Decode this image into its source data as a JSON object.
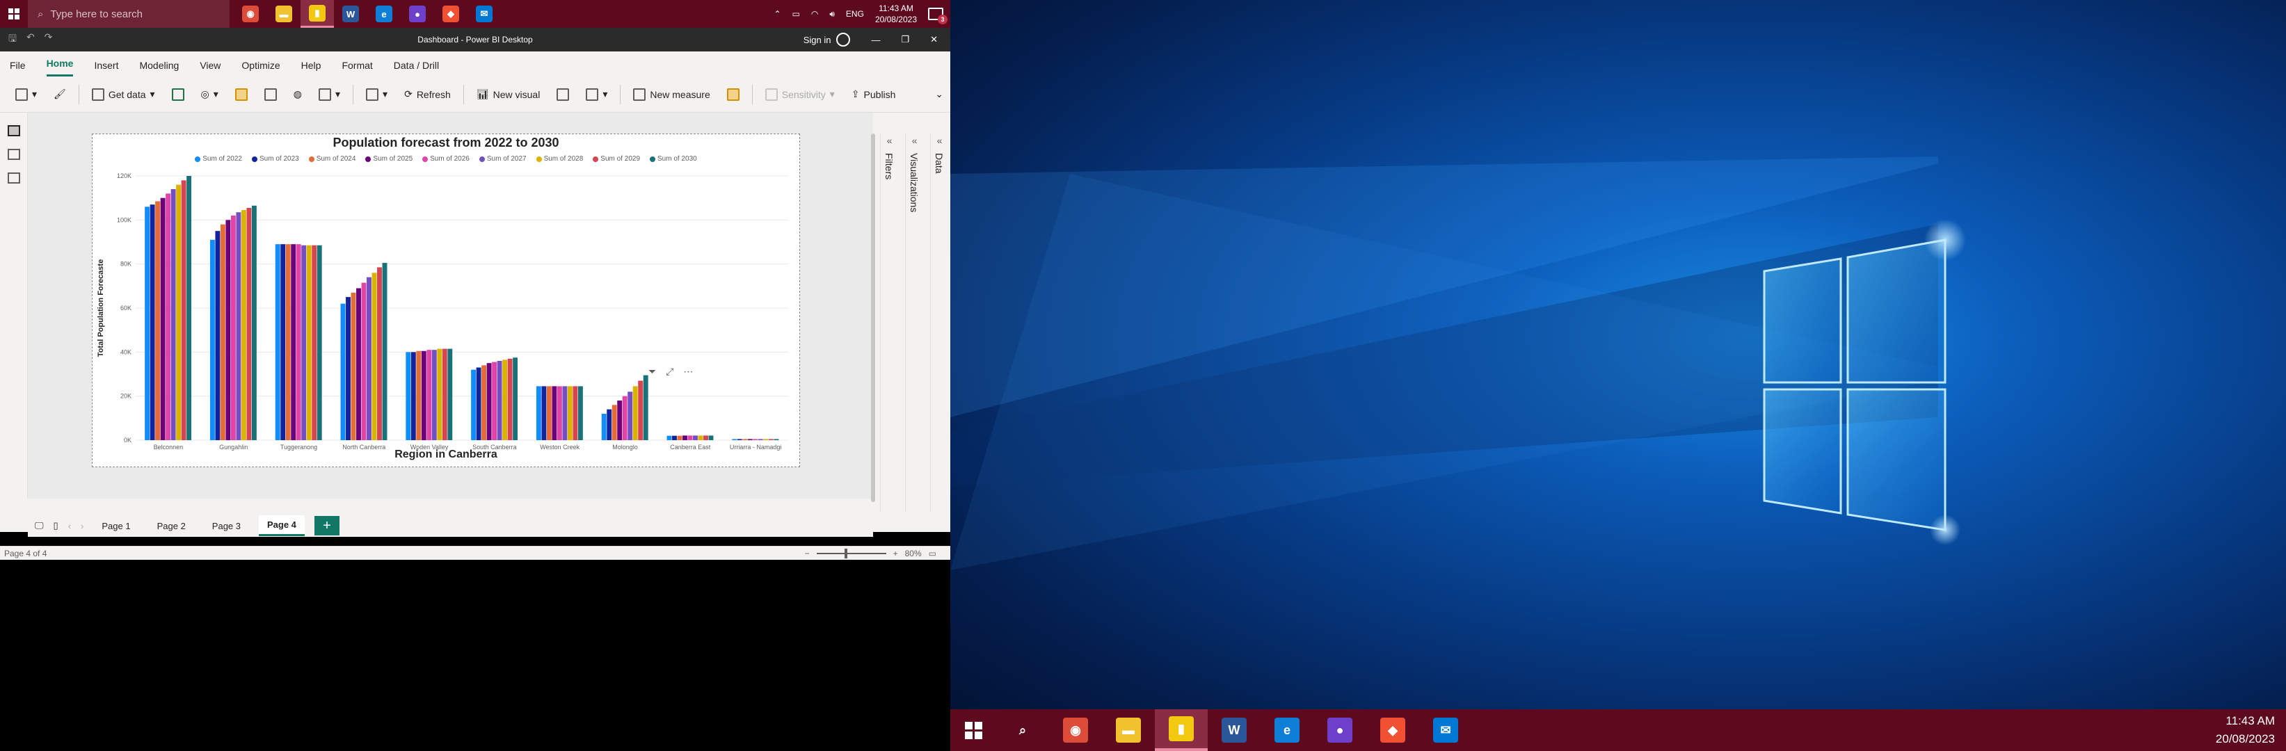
{
  "taskbar_top": {
    "search_placeholder": "Type here to search",
    "apps": [
      {
        "name": "chrome",
        "color": "#dd4b39",
        "glyph": "◉"
      },
      {
        "name": "file-explorer",
        "color": "#f2c12e",
        "glyph": "▬"
      },
      {
        "name": "power-bi",
        "color": "#f2c811",
        "glyph": "▮",
        "active": true
      },
      {
        "name": "word",
        "color": "#2b579a",
        "glyph": "W"
      },
      {
        "name": "edge",
        "color": "#0f7ed7",
        "glyph": "e"
      },
      {
        "name": "github",
        "color": "#6e40c9",
        "glyph": "●"
      },
      {
        "name": "git",
        "color": "#f05133",
        "glyph": "◆"
      },
      {
        "name": "mail",
        "color": "#0078d4",
        "glyph": "✉"
      }
    ],
    "tray_lang": "ENG",
    "time": "11:43 AM",
    "date": "20/08/2023",
    "notification_count": "3"
  },
  "window": {
    "title": "Dashboard - Power BI Desktop",
    "sign_in": "Sign in"
  },
  "menu": [
    "File",
    "Home",
    "Insert",
    "Modeling",
    "View",
    "Optimize",
    "Help",
    "Format",
    "Data / Drill"
  ],
  "menu_active": "Home",
  "ribbon": {
    "get_data": "Get data",
    "refresh": "Refresh",
    "new_visual": "New visual",
    "new_measure": "New measure",
    "sensitivity": "Sensitivity",
    "publish": "Publish"
  },
  "panes": {
    "filters": "Filters",
    "visualizations": "Visualizations",
    "data": "Data"
  },
  "pages": [
    "Page 1",
    "Page 2",
    "Page 3",
    "Page 4"
  ],
  "page_selected": "Page 4",
  "status": {
    "page_info": "Page 4 of 4",
    "zoom": "80%"
  },
  "chart_data": {
    "type": "bar",
    "title": "Population forecast from 2022 to 2030",
    "xlabel": "Region in Canberra",
    "ylabel": "Total Population Forecaste",
    "ylim": [
      0,
      120000
    ],
    "yticks": [
      0,
      20000,
      40000,
      60000,
      80000,
      100000,
      120000
    ],
    "ytick_labels": [
      "0K",
      "20K",
      "40K",
      "60K",
      "80K",
      "100K",
      "120K"
    ],
    "legend_position": "top-center",
    "categories": [
      "Belconnen",
      "Gungahlin",
      "Tuggeranong",
      "North Canberra",
      "Woden Valley",
      "South Canberra",
      "Weston Creek",
      "Molonglo",
      "Canberra East",
      "Urriarra - Namadgi"
    ],
    "series": [
      {
        "name": "Sum of 2022",
        "color": "#118dff",
        "values": [
          106000,
          91000,
          89000,
          62000,
          40000,
          32000,
          24500,
          12000,
          2000,
          500
        ]
      },
      {
        "name": "Sum of 2023",
        "color": "#12239e",
        "values": [
          107000,
          95000,
          89000,
          65000,
          40000,
          33000,
          24500,
          14000,
          2000,
          500
        ]
      },
      {
        "name": "Sum of 2024",
        "color": "#e66c37",
        "values": [
          108500,
          98000,
          89000,
          67000,
          40500,
          34000,
          24500,
          16000,
          2000,
          500
        ]
      },
      {
        "name": "Sum of 2025",
        "color": "#6b007b",
        "values": [
          110000,
          100000,
          89000,
          69000,
          40500,
          35000,
          24500,
          18000,
          2100,
          500
        ]
      },
      {
        "name": "Sum of 2026",
        "color": "#e044a7",
        "values": [
          112000,
          102000,
          89000,
          71500,
          41000,
          35500,
          24500,
          20000,
          2100,
          500
        ]
      },
      {
        "name": "Sum of 2027",
        "color": "#744ec2",
        "values": [
          114000,
          103500,
          88500,
          74000,
          41000,
          36000,
          24500,
          22000,
          2100,
          500
        ]
      },
      {
        "name": "Sum of 2028",
        "color": "#d9b300",
        "values": [
          116000,
          104500,
          88500,
          76000,
          41500,
          36500,
          24500,
          24500,
          2100,
          500
        ]
      },
      {
        "name": "Sum of 2029",
        "color": "#d64550",
        "values": [
          118000,
          105500,
          88500,
          78500,
          41500,
          37000,
          24500,
          27000,
          2100,
          500
        ]
      },
      {
        "name": "Sum of 2030",
        "color": "#197278",
        "values": [
          120000,
          106500,
          88500,
          80500,
          41500,
          37500,
          24500,
          29500,
          2100,
          500
        ]
      }
    ]
  },
  "taskbar_bottom": {
    "apps": [
      {
        "name": "search",
        "color": "#5e0a1e",
        "glyph": "⌕"
      },
      {
        "name": "chrome",
        "color": "#dd4b39",
        "glyph": "◉"
      },
      {
        "name": "file-explorer",
        "color": "#f2c12e",
        "glyph": "▬"
      },
      {
        "name": "power-bi",
        "color": "#f2c811",
        "glyph": "▮",
        "active": true
      },
      {
        "name": "word",
        "color": "#2b579a",
        "glyph": "W"
      },
      {
        "name": "edge",
        "color": "#0f7ed7",
        "glyph": "e"
      },
      {
        "name": "github",
        "color": "#6e40c9",
        "glyph": "●"
      },
      {
        "name": "git",
        "color": "#f05133",
        "glyph": "◆"
      },
      {
        "name": "mail",
        "color": "#0078d4",
        "glyph": "✉"
      }
    ],
    "time": "11:43 AM",
    "date": "20/08/2023"
  }
}
